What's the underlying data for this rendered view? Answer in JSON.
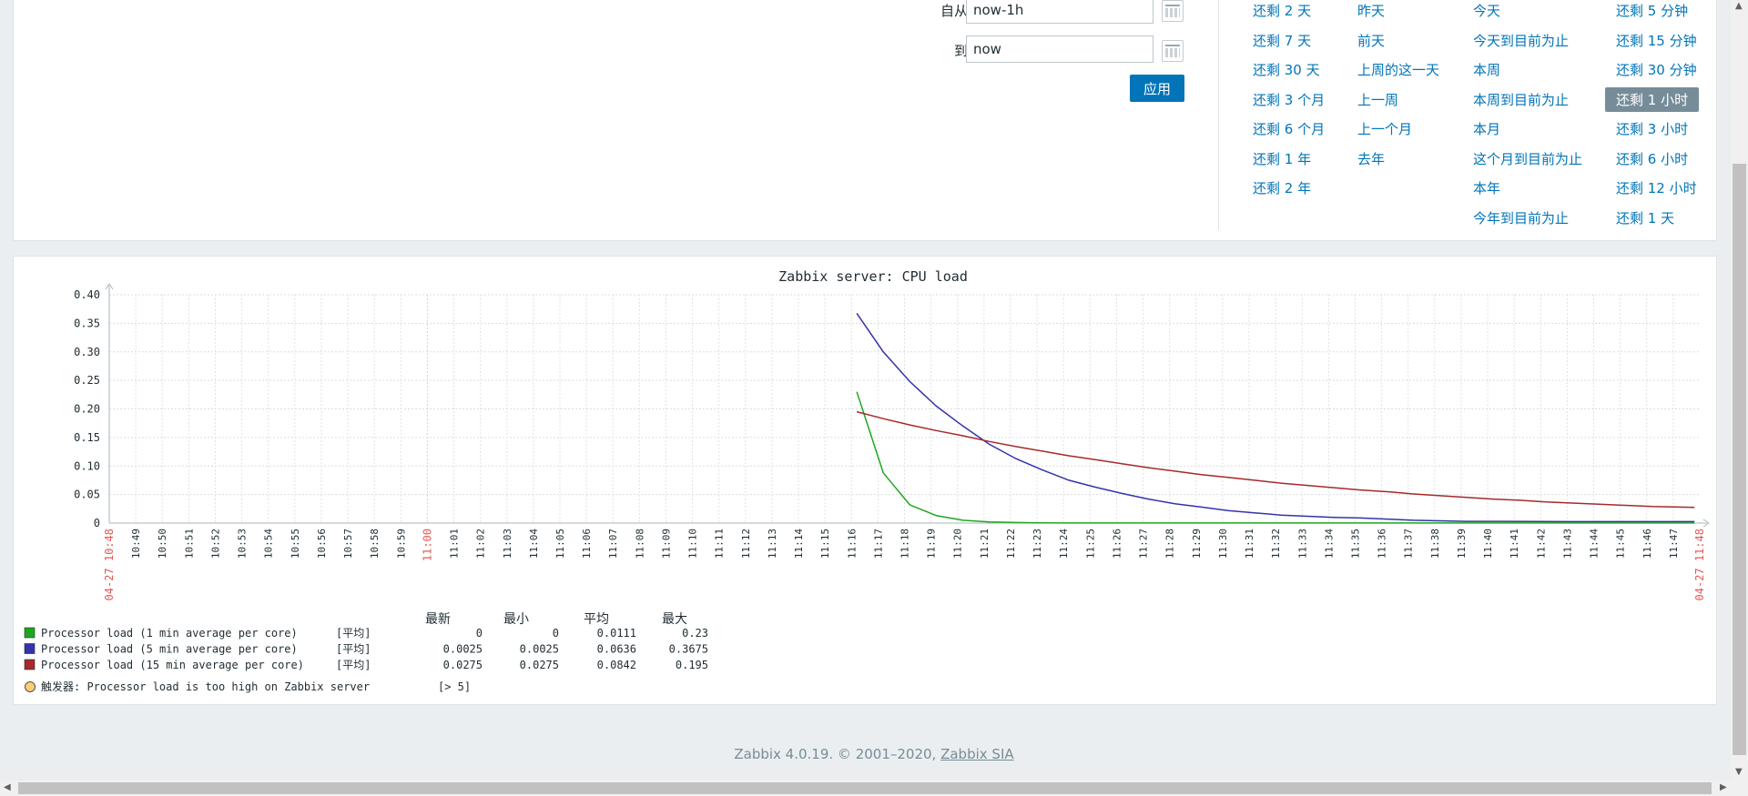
{
  "filter": {
    "from_label": "自从",
    "from_value": "now-1h",
    "to_label": "到",
    "to_value": "now",
    "apply_label": "应用"
  },
  "quick_ranges": {
    "col1": [
      "还剩 2 天",
      "还剩 7 天",
      "还剩 30 天",
      "还剩 3 个月",
      "还剩 6 个月",
      "还剩 1 年",
      "还剩 2 年"
    ],
    "col2": [
      "昨天",
      "前天",
      "上周的这一天",
      "上一周",
      "上一个月",
      "去年"
    ],
    "col3": [
      "今天",
      "今天到目前为止",
      "本周",
      "本周到目前为止",
      "本月",
      "这个月到目前为止",
      "本年",
      "今年到目前为止"
    ],
    "col4": [
      "还剩 5 分钟",
      "还剩 15 分钟",
      "还剩 30 分钟",
      "还剩 1 小时",
      "还剩 3 小时",
      "还剩 6 小时",
      "还剩 12 小时",
      "还剩 1 天"
    ],
    "active": "还剩 1 小时"
  },
  "chart_data": {
    "type": "line",
    "title": "Zabbix server: CPU load",
    "ylim": [
      0,
      0.4
    ],
    "yticks": [
      "0",
      "0.05",
      "0.10",
      "0.15",
      "0.20",
      "0.25",
      "0.30",
      "0.35",
      "0.40"
    ],
    "x_start_label": "04-27 10:48",
    "x_end_label": "04-27 11:48",
    "x_hour_label": "11:00",
    "x_minute_labels": [
      "10:49",
      "10:50",
      "10:51",
      "10:52",
      "10:53",
      "10:54",
      "10:55",
      "10:56",
      "10:57",
      "10:58",
      "10:59",
      "11:01",
      "11:02",
      "11:03",
      "11:04",
      "11:05",
      "11:06",
      "11:07",
      "11:08",
      "11:09",
      "11:10",
      "11:11",
      "11:12",
      "11:13",
      "11:14",
      "11:15",
      "11:16",
      "11:17",
      "11:18",
      "11:19",
      "11:20",
      "11:21",
      "11:22",
      "11:23",
      "11:24",
      "11:25",
      "11:26",
      "11:27",
      "11:28",
      "11:29",
      "11:30",
      "11:31",
      "11:32",
      "11:33",
      "11:34",
      "11:35",
      "11:36",
      "11:37",
      "11:38",
      "11:39",
      "11:40",
      "11:41",
      "11:42",
      "11:43",
      "11:44",
      "11:45",
      "11:46",
      "11:47"
    ],
    "series": [
      {
        "name": "Processor load (1 min average per core)",
        "color": "#1ea71e",
        "x": [
          28.2,
          29.2,
          30.2,
          31.2,
          32.2,
          33.2,
          34.2,
          35.2,
          36.2,
          40,
          45,
          50,
          55,
          59.8
        ],
        "values": [
          0.23,
          0.088,
          0.032,
          0.013,
          0.005,
          0.002,
          0.001,
          0.0005,
          0.0002,
          0.0001,
          0.0001,
          0.0001,
          0.0001,
          0.0001
        ]
      },
      {
        "name": "Processor load (5 min average per core)",
        "color": "#3333aa",
        "x": [
          28.2,
          29.2,
          30.2,
          31.2,
          32.2,
          33.2,
          34.2,
          35.2,
          36.2,
          37.2,
          38.2,
          39.2,
          40.2,
          41.2,
          42.2,
          43.2,
          44.2,
          45.2,
          46.2,
          47.2,
          48.2,
          49.2,
          50.2,
          51.2,
          52.2,
          55,
          59.8
        ],
        "values": [
          0.3675,
          0.3,
          0.248,
          0.205,
          0.17,
          0.138,
          0.113,
          0.093,
          0.075,
          0.063,
          0.052,
          0.042,
          0.034,
          0.028,
          0.022,
          0.018,
          0.014,
          0.012,
          0.01,
          0.009,
          0.007,
          0.005,
          0.004,
          0.003,
          0.003,
          0.0025,
          0.0025
        ]
      },
      {
        "name": "Processor load (15 min average per core)",
        "color": "#a52a2a",
        "x": [
          28.2,
          29.2,
          30.2,
          31.2,
          32.2,
          33.2,
          34.2,
          35.2,
          36.2,
          37.2,
          38.2,
          39.2,
          40.2,
          41.2,
          42.2,
          43.2,
          44.2,
          45.2,
          46.2,
          47.2,
          48.2,
          49.2,
          50.2,
          51.2,
          52.2,
          53.2,
          54.2,
          55.2,
          56.2,
          57.2,
          58.2,
          59.8
        ],
        "values": [
          0.195,
          0.183,
          0.172,
          0.162,
          0.153,
          0.143,
          0.134,
          0.126,
          0.118,
          0.111,
          0.104,
          0.097,
          0.091,
          0.085,
          0.08,
          0.075,
          0.07,
          0.066,
          0.062,
          0.058,
          0.055,
          0.051,
          0.048,
          0.045,
          0.042,
          0.04,
          0.037,
          0.035,
          0.033,
          0.031,
          0.029,
          0.0275
        ]
      }
    ],
    "legend": {
      "headers": [
        "最新",
        "最小",
        "平均",
        "最大"
      ],
      "func": "[平均]",
      "rows": [
        {
          "last": "0",
          "min": "0",
          "avg": "0.0111",
          "max": "0.23"
        },
        {
          "last": "0.0025",
          "min": "0.0025",
          "avg": "0.0636",
          "max": "0.3675"
        },
        {
          "last": "0.0275",
          "min": "0.0275",
          "avg": "0.0842",
          "max": "0.195"
        }
      ],
      "trigger_label": "触发器: Processor load is too high on Zabbix server",
      "trigger_value": "[> 5]",
      "trigger_color": "#ffcc77"
    }
  },
  "footer": {
    "version": "Zabbix 4.0.19. © 2001–2020,",
    "company": "Zabbix SIA"
  }
}
